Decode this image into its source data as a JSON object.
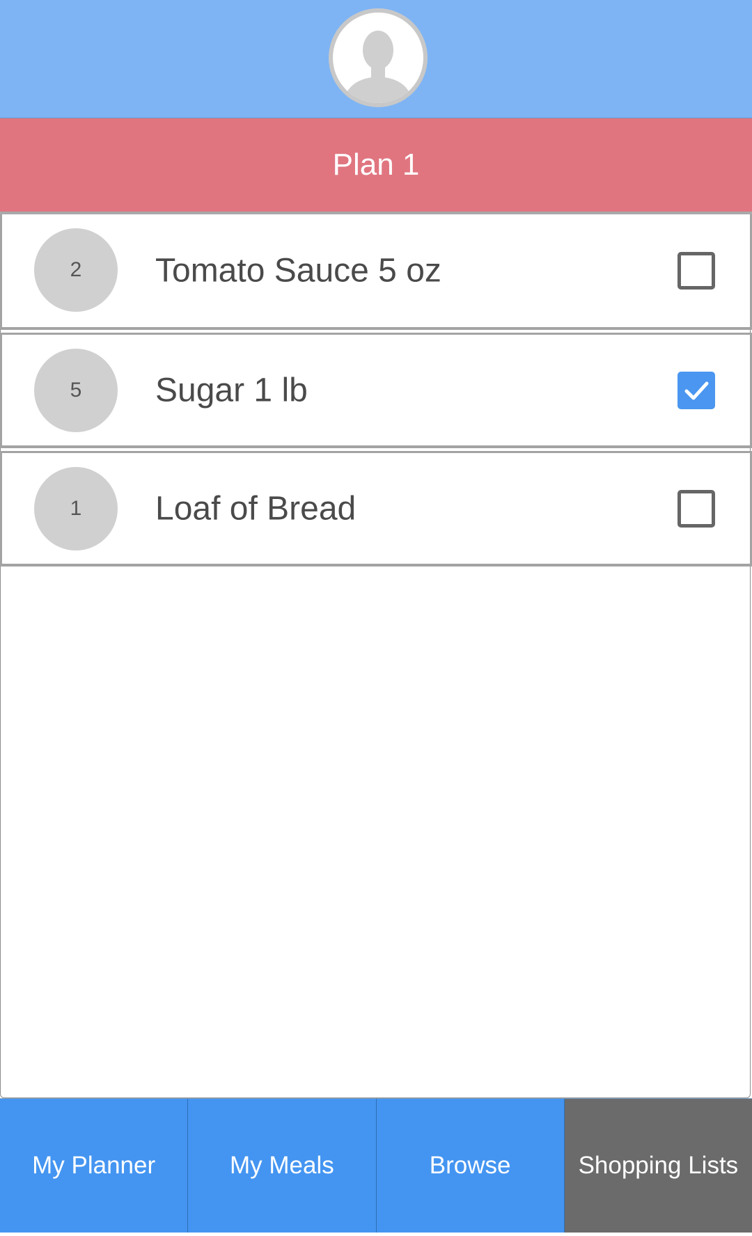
{
  "header": {
    "avatar_icon": "user-avatar-icon",
    "background": "#7eb4f4"
  },
  "plan": {
    "title": "Plan 1",
    "background": "#e07580"
  },
  "items": [
    {
      "qty": "2",
      "label": "Tomato Sauce 5 oz",
      "checked": false
    },
    {
      "qty": "5",
      "label": "Sugar 1 lb",
      "checked": true
    },
    {
      "qty": "1",
      "label": "Loaf of Bread",
      "checked": false
    }
  ],
  "tabs": [
    {
      "label": "My Planner",
      "active": false
    },
    {
      "label": "My Meals",
      "active": false
    },
    {
      "label": "Browse",
      "active": false
    },
    {
      "label": "Shopping Lists",
      "active": true
    }
  ],
  "colors": {
    "accent": "#4495f1",
    "active_tab": "#6b6b6b",
    "checkbox_checked": "#4a96f0"
  }
}
